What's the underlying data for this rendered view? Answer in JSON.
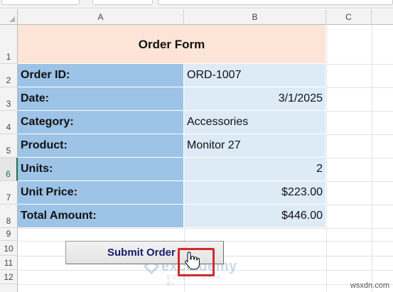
{
  "sheet": {
    "columns": [
      "A",
      "B",
      "C"
    ],
    "rows": [
      "1",
      "2",
      "3",
      "4",
      "5",
      "6",
      "7",
      "8",
      "9",
      "10",
      "11",
      "12"
    ],
    "active_row": "6"
  },
  "form": {
    "title": "Order Form",
    "fields": [
      {
        "label": "Order ID:",
        "value": "ORD-1007",
        "align": "left"
      },
      {
        "label": "Date:",
        "value": "3/1/2025",
        "align": "right"
      },
      {
        "label": "Category:",
        "value": "Accessories",
        "align": "left"
      },
      {
        "label": "Product:",
        "value": "Monitor 27",
        "align": "left"
      },
      {
        "label": "Units:",
        "value": "2",
        "align": "right"
      },
      {
        "label": "Unit Price:",
        "value": "$223.00",
        "align": "right"
      },
      {
        "label": "Total Amount:",
        "value": "$446.00",
        "align": "right"
      }
    ]
  },
  "button": {
    "label": "Submit Order"
  },
  "watermark": {
    "name": "exceldemy",
    "tagline": "EXCEL · DATA · BI"
  },
  "site": "wsxdn.com",
  "colors": {
    "title_fill": "#fce4d6",
    "label_fill": "#9dc3e6",
    "value_fill": "#ddebf7",
    "highlight": "#d32a2a",
    "button_text": "#1b1b6b"
  }
}
